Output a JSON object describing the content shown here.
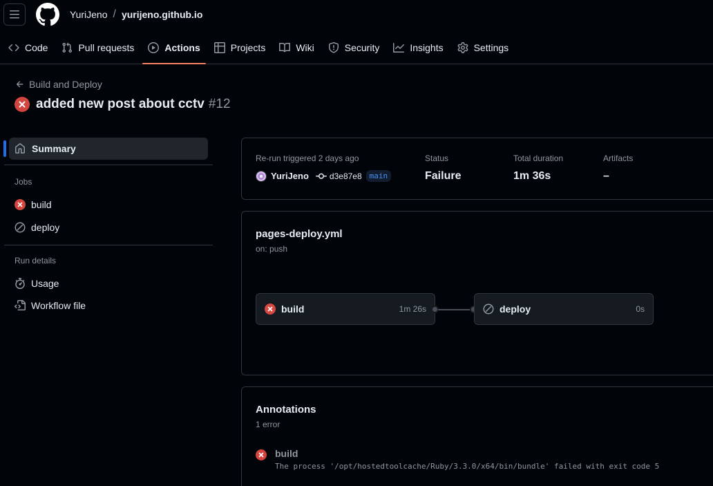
{
  "repo": {
    "owner": "YuriJeno",
    "separator": "/",
    "name": "yurijeno.github.io"
  },
  "nav": {
    "tabs": [
      {
        "label": "Code",
        "icon": "code-icon"
      },
      {
        "label": "Pull requests",
        "icon": "pull-request-icon"
      },
      {
        "label": "Actions",
        "icon": "play-icon",
        "active": true
      },
      {
        "label": "Projects",
        "icon": "table-icon"
      },
      {
        "label": "Wiki",
        "icon": "book-icon"
      },
      {
        "label": "Security",
        "icon": "shield-icon"
      },
      {
        "label": "Insights",
        "icon": "graph-icon"
      },
      {
        "label": "Settings",
        "icon": "gear-icon"
      }
    ]
  },
  "run": {
    "back_label": "Build and Deploy",
    "title": "added new post about cctv",
    "number": "#12"
  },
  "sidebar": {
    "summary_label": "Summary",
    "jobs_heading": "Jobs",
    "jobs": [
      {
        "label": "build",
        "status": "failure"
      },
      {
        "label": "deploy",
        "status": "skipped"
      }
    ],
    "details_heading": "Run details",
    "details": [
      {
        "label": "Usage",
        "icon": "stopwatch-icon"
      },
      {
        "label": "Workflow file",
        "icon": "file-code-icon"
      }
    ]
  },
  "summary": {
    "trigger_label": "Re-run triggered 2 days ago",
    "actor": "YuriJeno",
    "commit": "d3e87e8",
    "branch": "main",
    "status_label": "Status",
    "status_value": "Failure",
    "duration_label": "Total duration",
    "duration_value": "1m 36s",
    "artifacts_label": "Artifacts",
    "artifacts_value": "–"
  },
  "workflow": {
    "file": "pages-deploy.yml",
    "trigger": "on: push",
    "jobs": [
      {
        "name": "build",
        "duration": "1m 26s",
        "status": "failure"
      },
      {
        "name": "deploy",
        "duration": "0s",
        "status": "skipped"
      }
    ]
  },
  "annotations": {
    "title": "Annotations",
    "count": "1 error",
    "items": [
      {
        "job": "build",
        "message": "The process '/opt/hostedtoolcache/Ruby/3.3.0/x64/bin/bundle' failed with exit code 5"
      }
    ]
  },
  "colors": {
    "failure": "#f85149",
    "accent": "#f78166",
    "link": "#4493f8",
    "selected_bar": "#1f6feb"
  }
}
